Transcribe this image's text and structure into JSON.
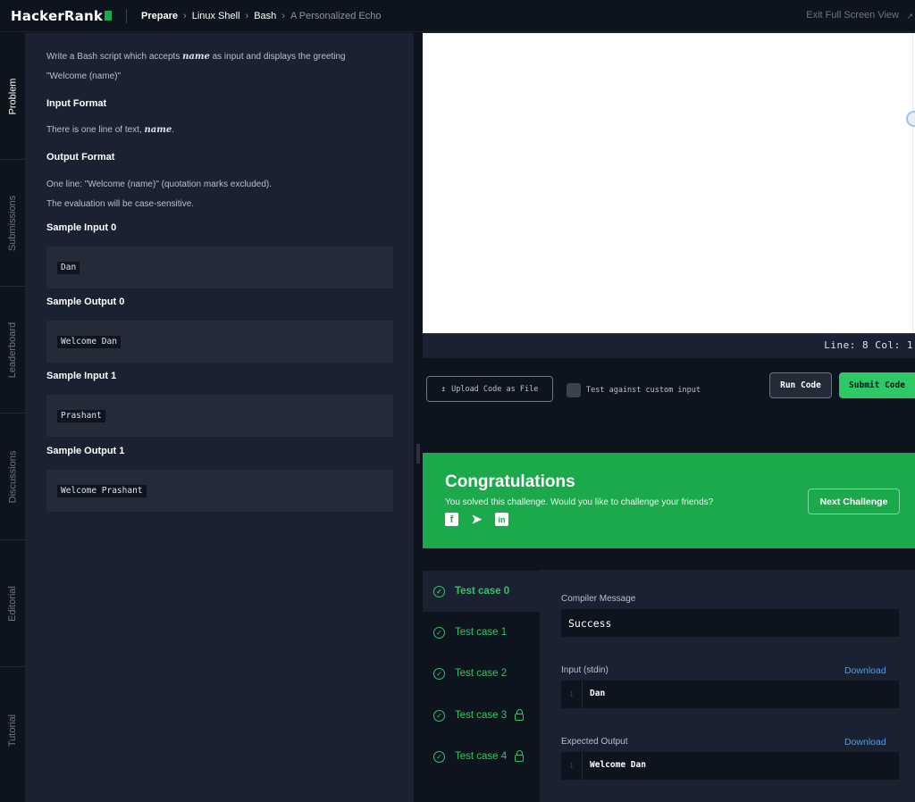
{
  "topbar": {
    "logo": "HackerRank",
    "breadcrumbs": [
      "Prepare",
      "Linux Shell",
      "Bash",
      "A Personalized Echo"
    ],
    "exit_label": "Exit Full Screen View"
  },
  "side_tabs": [
    "Problem",
    "Submissions",
    "Leaderboard",
    "Discussions",
    "Editorial",
    "Tutorial"
  ],
  "problem": {
    "intro_pre": "Write a Bash script which accepts ",
    "intro_var": "name",
    "intro_post": " as input and displays the greeting",
    "intro_line2": "\"Welcome (name)\"",
    "input_format_heading": "Input Format",
    "input_format_pre": "There is one line of text, ",
    "input_format_var": "name",
    "input_format_post": ".",
    "output_format_heading": "Output Format",
    "output_format_line1": "One line: \"Welcome (name)\" (quotation marks excluded).",
    "output_format_line2": "The evaluation will be case-sensitive.",
    "samples": [
      {
        "heading": "Sample Input 0",
        "code": "Dan"
      },
      {
        "heading": "Sample Output 0",
        "code": "Welcome Dan"
      },
      {
        "heading": "Sample Input 1",
        "code": "Prashant"
      },
      {
        "heading": "Sample Output 1",
        "code": "Welcome Prashant"
      }
    ]
  },
  "editor": {
    "status": "Line: 8 Col: 1"
  },
  "actions": {
    "upload_label": "Upload Code as File",
    "custom_input_label": "Test against custom input",
    "run_label": "Run Code",
    "submit_label": "Submit Code"
  },
  "congrats": {
    "title": "Congratulations",
    "subtitle": "You solved this challenge. Would you like to challenge your friends?",
    "social": [
      "facebook-icon",
      "twitter-icon",
      "linkedin-icon"
    ],
    "next_label": "Next Challenge"
  },
  "results": {
    "test_cases": [
      {
        "label": "Test case 0",
        "locked": false
      },
      {
        "label": "Test case 1",
        "locked": false
      },
      {
        "label": "Test case 2",
        "locked": false
      },
      {
        "label": "Test case 3",
        "locked": true
      },
      {
        "label": "Test case 4",
        "locked": true
      }
    ],
    "compiler_label": "Compiler Message",
    "compiler_message": "Success",
    "input_label": "Input (stdin)",
    "input_line_no": "1",
    "input_value": "Dan",
    "expected_label": "Expected Output",
    "expected_line_no": "1",
    "expected_value": "Welcome Dan",
    "download_label": "Download"
  },
  "colors": {
    "accent_green": "#2ec866",
    "banner_green": "#1ba94c",
    "link_blue": "#4b9ff5",
    "background": "#0e141e",
    "panel": "#1a2130"
  }
}
